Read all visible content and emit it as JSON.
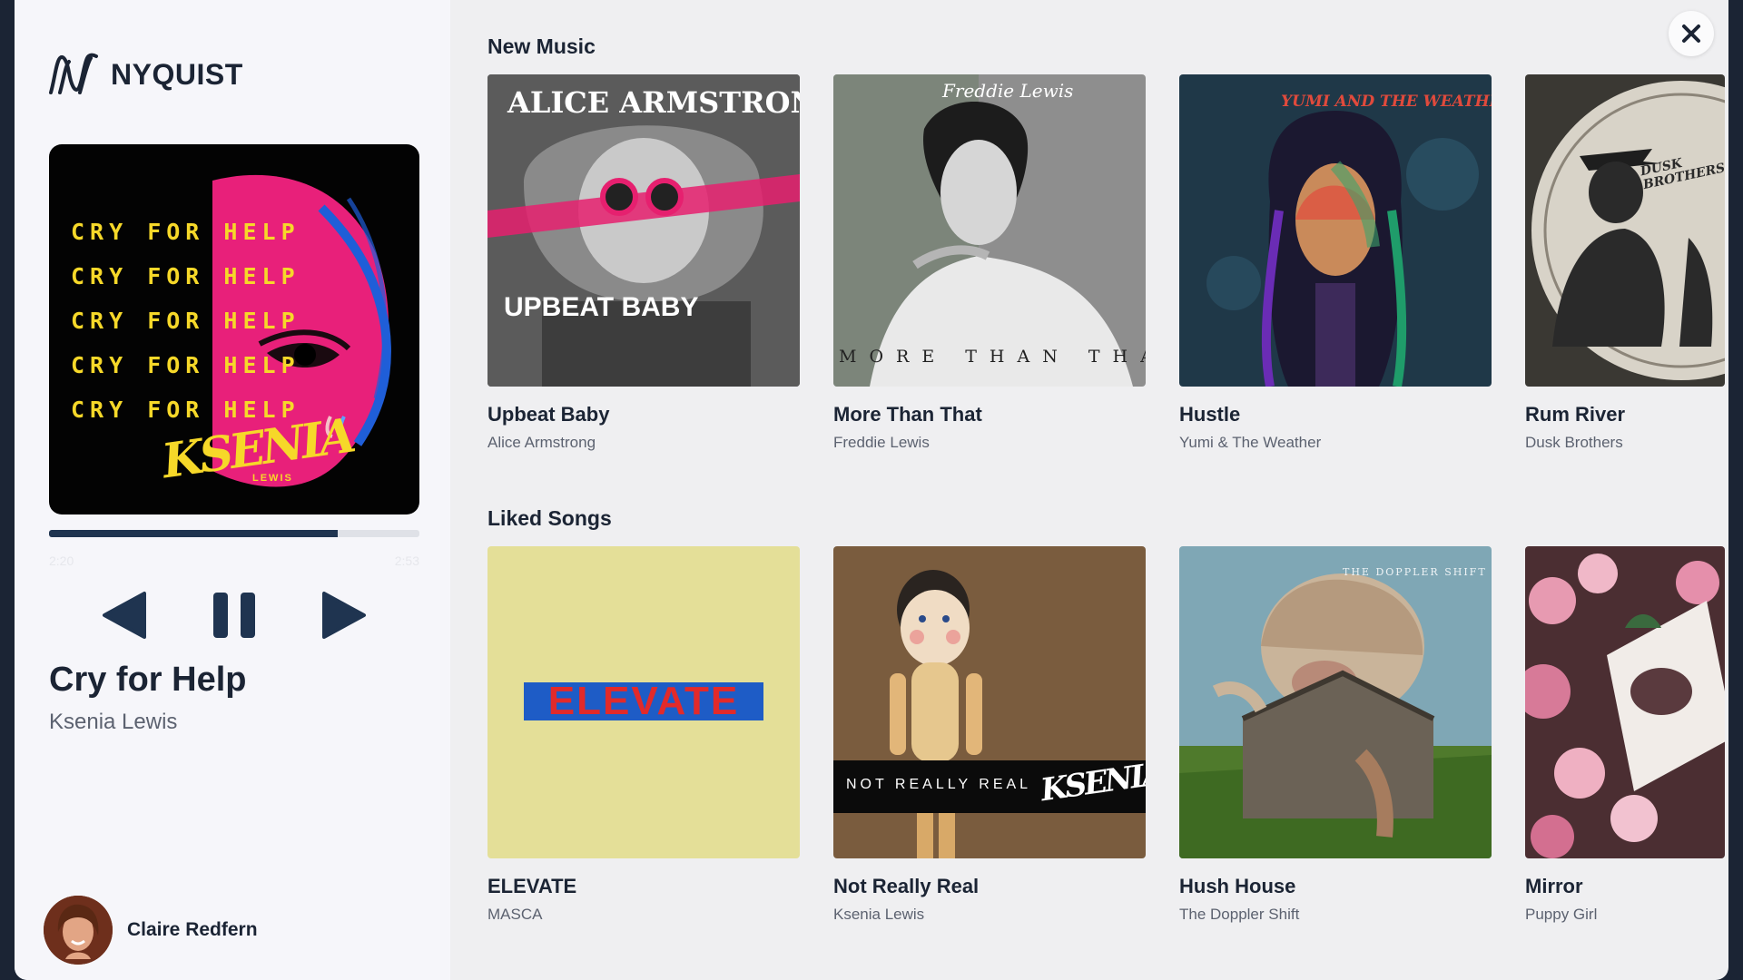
{
  "app": {
    "brand": "NYQUIST"
  },
  "now_playing": {
    "cover_line": "CRY FOR HELP",
    "cover_artist": "KSENIA",
    "cover_artist_sub": "LEWIS",
    "progress": 0.78,
    "time_elapsed": "2:20",
    "time_total": "2:53",
    "title": "Cry for Help",
    "artist": "Ksenia Lewis"
  },
  "user": {
    "name": "Claire Redfern"
  },
  "sections": {
    "new_music": {
      "title": "New Music",
      "items": [
        {
          "title": "Upbeat Baby",
          "artist": "Alice Armstrong",
          "cover_top": "ALICE ARMSTRONG",
          "cover_bottom": "UPBEAT BABY"
        },
        {
          "title": "More Than That",
          "artist": "Freddie Lewis",
          "cover_top": "Freddie Lewis",
          "cover_bottom": "MORE THAN THAT"
        },
        {
          "title": "Hustle",
          "artist": "Yumi & The Weather",
          "cover_top": "YUMI AND THE WEATHER"
        },
        {
          "title": "Rum River",
          "artist": "Dusk Brothers",
          "cover_top": "DUSK BROTHERS"
        }
      ]
    },
    "liked_songs": {
      "title": "Liked Songs",
      "items": [
        {
          "title": "ELEVATE",
          "artist": "MASCA",
          "cover_top": "ELEVATE"
        },
        {
          "title": "Not Really Real",
          "artist": "Ksenia Lewis",
          "cover_top": "NOT REALLY REAL",
          "cover_bottom": "KSENIA"
        },
        {
          "title": "Hush House",
          "artist": "The Doppler Shift",
          "cover_top": "THE DOPPLER SHIFT"
        },
        {
          "title": "Mirror",
          "artist": "Puppy Girl"
        }
      ]
    }
  },
  "colors": {
    "accent": "#1f3450",
    "text": "#1b2434",
    "muted": "#5c6270",
    "yellow": "#f6d829",
    "pink": "#e8207a"
  },
  "icons": [
    "nyquist-logo-icon",
    "previous-icon",
    "pause-icon",
    "next-icon",
    "close-icon"
  ]
}
